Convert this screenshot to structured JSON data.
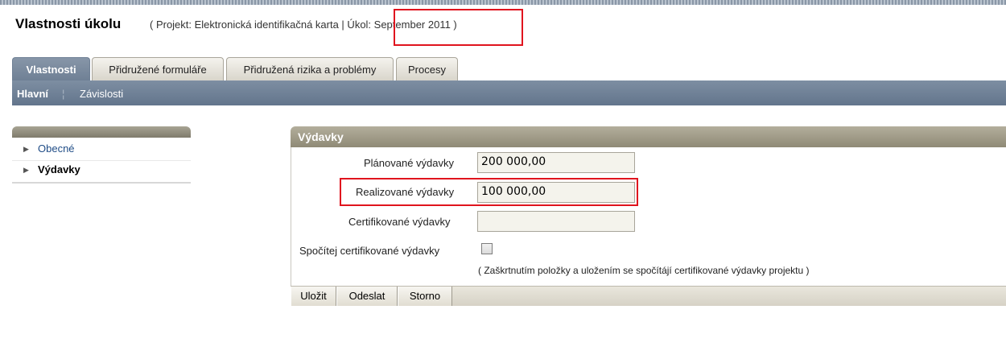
{
  "header": {
    "title": "Vlastnosti úkolu",
    "subtitle": "( Projekt: Elektronická identifikačná karta | Úkol: September 2011 )"
  },
  "tabs": [
    {
      "label": "Vlastnosti",
      "active": true
    },
    {
      "label": "Přidružené formuláře",
      "active": false
    },
    {
      "label": "Přidružená rizika a problémy",
      "active": false
    },
    {
      "label": "Procesy",
      "active": false
    }
  ],
  "subnav": {
    "main": "Hlavní",
    "separator": "¦",
    "dependencies": "Závislosti"
  },
  "sidebar": {
    "items": [
      {
        "label": "Obecné",
        "selected": false
      },
      {
        "label": "Výdavky",
        "selected": true
      }
    ]
  },
  "panel": {
    "title": "Výdavky",
    "fields": [
      {
        "label": "Plánované výdavky",
        "value": "200 000,00"
      },
      {
        "label": "Realizované výdavky",
        "value": "100 000,00"
      },
      {
        "label": "Certifikované výdavky",
        "value": ""
      }
    ],
    "checkbox": {
      "label": "Spočítej certifikované výdavky",
      "checked": false,
      "hint": "( Zaškrtnutím položky a uložením se spočítájí certifikované výdavky projektu )"
    }
  },
  "buttons": {
    "save": "Uložit",
    "send": "Odeslat",
    "cancel": "Storno"
  },
  "colors": {
    "highlight": "#e0141e",
    "tab_active": "#7d8ea2",
    "panel_header": "#a3a08f",
    "link": "#1f4c86"
  }
}
